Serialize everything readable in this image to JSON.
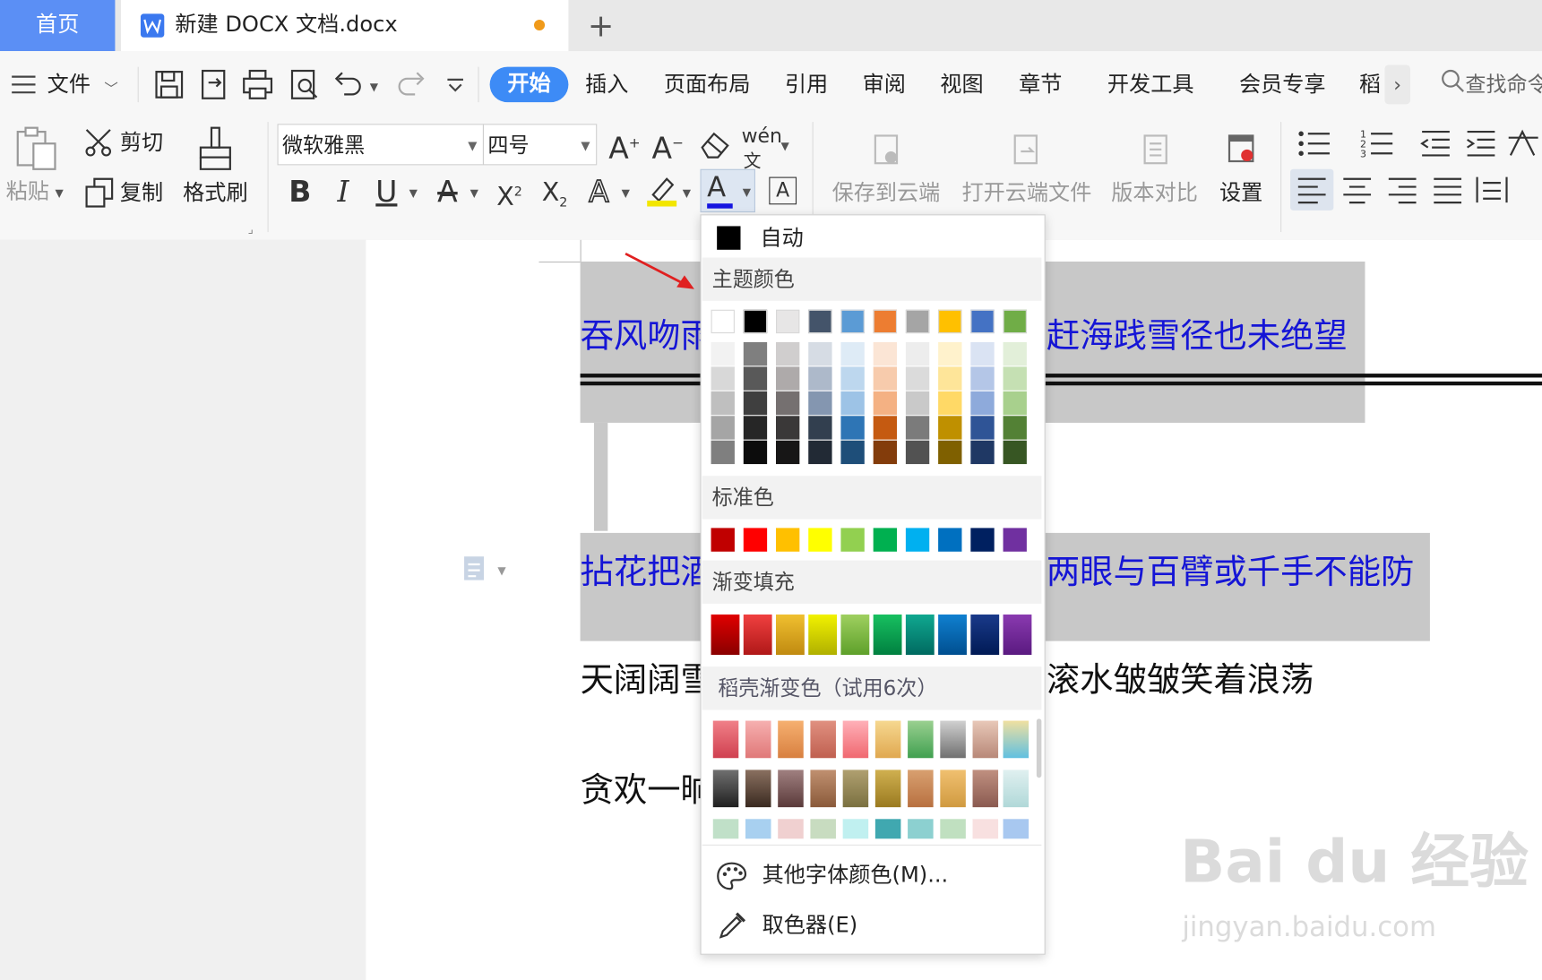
{
  "tabs": {
    "home": "首页",
    "doc_title": "新建 DOCX 文档.docx",
    "new_tab": "+"
  },
  "menu": {
    "file": "文件",
    "items": [
      "开始",
      "插入",
      "页面布局",
      "引用",
      "审阅",
      "视图",
      "章节",
      "开发工具",
      "会员专享",
      "稻"
    ],
    "more": "›",
    "search": "查找命令"
  },
  "ribbon": {
    "paste": "粘贴",
    "cut": "剪切",
    "copy": "复制",
    "format_painter": "格式刷",
    "font_name": "微软雅黑",
    "font_size": "四号",
    "save_cloud": "保存到云端",
    "open_cloud": "打开云端文件",
    "compare": "版本对比",
    "settings": "设置",
    "phonetic": "wén"
  },
  "document": {
    "line1_left": "吞风吻雨",
    "line1_right": "赶海践雪径也未绝望",
    "line2_left": "拈花把酒",
    "line2_right": "两眼与百臂或千手不能防",
    "line3_left": "天阔阔雪",
    "line3_right": "滚水皱皱笑着浪荡",
    "line4_left": "贪欢一晌"
  },
  "dropdown": {
    "auto": "自动",
    "theme_colors": "主题颜色",
    "standard_colors": "标准色",
    "gradient_fill": "渐变填充",
    "premium_gradient": "稻壳渐变色（试用6次）",
    "more_colors": "其他字体颜色(M)...",
    "eyedropper": "取色器(E)",
    "theme_top": [
      "#ffffff",
      "#000000",
      "#e7e6e6",
      "#44546a",
      "#5b9bd5",
      "#ed7d31",
      "#a5a5a5",
      "#ffc000",
      "#4472c4",
      "#70ad47"
    ],
    "theme_shades": [
      [
        "#f2f2f2",
        "#7f7f7f",
        "#d0cece",
        "#d6dce4",
        "#deebf6",
        "#fbe5d5",
        "#ededed",
        "#fff2cc",
        "#dae3f3",
        "#e2efd9"
      ],
      [
        "#d8d8d8",
        "#595959",
        "#aeaaaa",
        "#adb9ca",
        "#bdd7ee",
        "#f7cbac",
        "#dbdbdb",
        "#fee599",
        "#b4c6e7",
        "#c5e0b3"
      ],
      [
        "#bfbfbf",
        "#3f3f3f",
        "#757070",
        "#8496b0",
        "#9dc3e6",
        "#f4b183",
        "#c9c9c9",
        "#ffd966",
        "#8eaadb",
        "#a8d08d"
      ],
      [
        "#a5a5a5",
        "#262626",
        "#3a3838",
        "#323f4f",
        "#2e75b5",
        "#c55a11",
        "#7b7b7b",
        "#bf9000",
        "#2f5496",
        "#538135"
      ],
      [
        "#7f7f7f",
        "#0c0c0c",
        "#171616",
        "#222a35",
        "#1e4e79",
        "#833c0b",
        "#525252",
        "#7f6000",
        "#1f3864",
        "#375623"
      ]
    ],
    "standard": [
      "#c00000",
      "#ff0000",
      "#ffc000",
      "#ffff00",
      "#92d050",
      "#00b050",
      "#00b0f0",
      "#0070c0",
      "#002060",
      "#7030a0"
    ],
    "gradients": [
      [
        "#e00000",
        "#8a0000"
      ],
      [
        "#f04040",
        "#b01818"
      ],
      [
        "#f0c030",
        "#c08a10"
      ],
      [
        "#f2f200",
        "#b0b000"
      ],
      [
        "#9fd060",
        "#5ea02a"
      ],
      [
        "#18c060",
        "#008040"
      ],
      [
        "#10a890",
        "#006a60"
      ],
      [
        "#1080d0",
        "#004f90"
      ],
      [
        "#1a3a8a",
        "#001a55"
      ],
      [
        "#8a3ab0",
        "#5a1a80"
      ]
    ],
    "premium_row1": [
      [
        "#f08088",
        "#d04050"
      ],
      [
        "#f6b0b0",
        "#e07878"
      ],
      [
        "#f6b070",
        "#d88040"
      ],
      [
        "#e09080",
        "#c06050"
      ],
      [
        "#ffb0b8",
        "#f06870"
      ],
      [
        "#f6d890",
        "#e0a850"
      ],
      [
        "#9ad090",
        "#40a050"
      ],
      [
        "#d0d0d0",
        "#707070"
      ],
      [
        "#e8c8b8",
        "#b88878"
      ],
      [
        "#f0e0a0",
        "#60c0e0"
      ]
    ],
    "premium_row2": [
      [
        "#707070",
        "#202020"
      ],
      [
        "#8a7060",
        "#3a2a20"
      ],
      [
        "#a08080",
        "#5a3a3a"
      ],
      [
        "#c09070",
        "#8a5a3a"
      ],
      [
        "#b0a070",
        "#7a7040"
      ],
      [
        "#d0b050",
        "#9a7a20"
      ],
      [
        "#d8a070",
        "#b87040"
      ],
      [
        "#f0c070",
        "#d09a40"
      ],
      [
        "#c09080",
        "#8a5a50"
      ],
      [
        "#e0f0f0",
        "#b0d8d8"
      ]
    ],
    "premium_row3": [
      "#c0e0c8",
      "#a8d0f0",
      "#f0d0d0",
      "#c8dcc0",
      "#c0f0f0",
      "#40a8b0",
      "#8cd0d0",
      "#c0e0c0",
      "#f8e0e0",
      "#a8c8f0"
    ]
  },
  "watermark": {
    "brand": "Bai du 经验",
    "url": "jingyan.baidu.com"
  }
}
